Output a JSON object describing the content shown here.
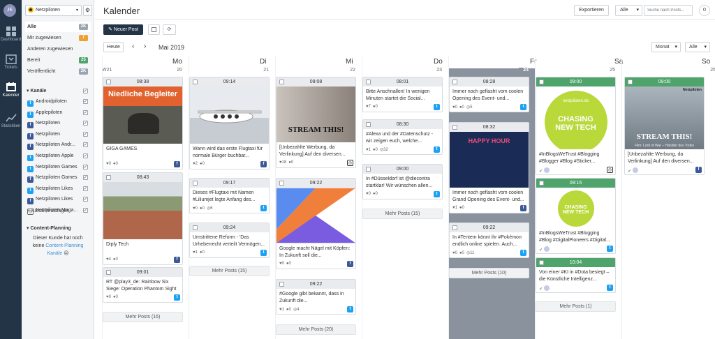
{
  "user": {
    "initials": "JE"
  },
  "rail": [
    {
      "label": "Dashboard",
      "icon": "dashboard-icon"
    },
    {
      "label": "Tickets",
      "icon": "tickets-icon"
    },
    {
      "label": "Kalender",
      "icon": "calendar-icon"
    },
    {
      "label": "Statistiken",
      "icon": "statistics-icon"
    }
  ],
  "sidebar": {
    "workspace": "Netzpiloten",
    "filters": [
      {
        "label": "Alle",
        "badge": "2K",
        "color": "#9aa5b1"
      },
      {
        "label": "Mir zugewiesen",
        "badge": "7",
        "color": "#f0a030"
      },
      {
        "label": "Anderen zugewiesen",
        "badge": "",
        "color": ""
      },
      {
        "label": "Bereit",
        "badge": "25",
        "color": "#4ea46a"
      },
      {
        "label": "Veröffentlicht",
        "badge": "2K",
        "color": "#9aa5b1"
      }
    ],
    "channels_title": "Kanäle",
    "channels": [
      {
        "label": "Androidpiloten",
        "net": "t"
      },
      {
        "label": "Applepiloten",
        "net": "t"
      },
      {
        "label": "Netzpiloten",
        "net": "f"
      },
      {
        "label": "Netzpiloten",
        "net": "f"
      },
      {
        "label": "Netzpiloten Andr...",
        "net": "f"
      },
      {
        "label": "Netzpiloten Apple",
        "net": "t"
      },
      {
        "label": "Netzpiloten Games",
        "net": "t"
      },
      {
        "label": "Netzpiloten Games",
        "net": "f"
      },
      {
        "label": "Netzpiloten Likes",
        "net": "t"
      },
      {
        "label": "Netzpiloten Likes",
        "net": "f"
      },
      {
        "label": "Netzpiloten Maga...",
        "net": "i"
      }
    ],
    "add_channel": "+ Kanal hinzufügen",
    "cp_title": "Content-Planning",
    "cp_line1": "Dieser Kunde hat noch",
    "cp_line2a": "keine",
    "cp_line2b": "Content-Planning",
    "cp_line3": "Kanäle"
  },
  "header": {
    "title": "Kalender",
    "export": "Exportieren",
    "filter_all": "Alle",
    "search_placeholder": "Suche nach Posts...",
    "count": "0"
  },
  "toolbar": {
    "new_post": "Neuer Post",
    "today": "Heute",
    "period": "Mai 2019",
    "view": "Monat",
    "filter": "Alle"
  },
  "week": "W21",
  "days": [
    {
      "name": "Mo",
      "num": "20",
      "more": "Mehr Posts (16)",
      "posts": [
        {
          "time": "08:38",
          "img": "niedlich",
          "text": "GIGA GAMES",
          "likes": "0",
          "comments": "0",
          "shares": "",
          "net": "f"
        },
        {
          "time": "08:43",
          "img": "construction",
          "text": "Diply Tech",
          "likes": "4",
          "comments": "0",
          "shares": "",
          "net": "f"
        },
        {
          "time": "09:01",
          "img": "",
          "text": "RT @play3_de: Rainbow Six Siege: Operation Phantom Sight –...",
          "likes": "0",
          "comments": "0",
          "shares": "",
          "net": "t"
        }
      ]
    },
    {
      "name": "Di",
      "num": "21",
      "more": "Mehr Posts (15)",
      "posts": [
        {
          "time": "09:14",
          "img": "plane",
          "text": "Wann wird das erste Flugtaxi für normale Bürger buchbar...",
          "likes": "2",
          "comments": "0",
          "shares": "",
          "net": "f"
        },
        {
          "time": "09:17",
          "img": "",
          "text": "Dieses #Flugtaxi mit Namen #Liliumjet legte Anfang des...",
          "likes": "0",
          "comments": "0",
          "shares": "6",
          "net": "t"
        },
        {
          "time": "09:24",
          "img": "",
          "text": "Umstrittene Reform - 'Das Urheberrecht verteilt Vermögen...",
          "likes": "1",
          "comments": "0",
          "shares": "",
          "net": "t"
        }
      ]
    },
    {
      "name": "Mi",
      "num": "22",
      "more": "Mehr Posts (20)",
      "posts": [
        {
          "time": "09:08",
          "img": "stream",
          "img_text": "STREAM THIS!",
          "text": "[Unbezahlte Werbung, da Verlinkung] Auf den diversen...",
          "likes": "18",
          "comments": "0",
          "shares": "",
          "net": "i"
        },
        {
          "time": "09:22",
          "img": "kotlin",
          "text": "Google macht Nägel mit Köpfen: In Zukunft soll die...",
          "likes": "0",
          "comments": "0",
          "shares": "",
          "net": "f"
        },
        {
          "time": "09:22",
          "img": "",
          "text": "#Google gibt bekannt, dass in Zukunft die...",
          "likes": "1",
          "comments": "0",
          "shares": "4",
          "net": "t"
        }
      ]
    },
    {
      "name": "Do",
      "num": "23",
      "more": "Mehr Posts (15)",
      "posts": [
        {
          "time": "08:01",
          "img": "",
          "text": "Bitte Anschnallen! In wenigen Minuten startet die Social...",
          "likes": "7",
          "comments": "0",
          "shares": "",
          "net": "t"
        },
        {
          "time": "08:30",
          "img": "",
          "text": "#Alexa und der #Datenschutz - wir zeigen euch, welche...",
          "likes": "1",
          "comments": "0",
          "shares": "32",
          "net": "t"
        },
        {
          "time": "09:00",
          "img": "",
          "text": "In #Düsseldorf ist @diecontra startklar! Wir wünschen allen...",
          "likes": "0",
          "comments": "0",
          "shares": "",
          "net": "t"
        }
      ]
    },
    {
      "name": "Fr",
      "num": "24",
      "more": "Mehr Posts (10)",
      "posts": [
        {
          "time": "08:28",
          "img": "",
          "text": "Immer noch geflasht vom coolen Opening des Event- und...",
          "likes": "0",
          "comments": "0",
          "shares": "5",
          "net": "t"
        },
        {
          "time": "08:32",
          "img": "happy",
          "img_text": "HAPPY HOUR",
          "text": "Immer noch geflasht vom coolen Grand Opening des Event- und...",
          "likes": "1",
          "comments": "0",
          "shares": "",
          "net": "f"
        },
        {
          "time": "09:22",
          "img": "",
          "text": "In #Tentem könnt ihr #Pokémon endlich online spielen. Auch...",
          "likes": "0",
          "comments": "0",
          "shares": "11",
          "net": "t"
        }
      ]
    },
    {
      "name": "Sa",
      "num": "25",
      "more": "Mehr Posts (1)",
      "posts": [
        {
          "time": "09:00",
          "img": "chasing",
          "img_brand": "netzpiloten.de",
          "img_text": "CHASING NEW TECH",
          "text": "#InBlogsWeTrust #Blogging #Blogger #Blog #Sticker...",
          "net": "i"
        },
        {
          "time": "09:15",
          "img": "chasing2",
          "img_text": "CHASING NEW TECH",
          "text": "#InBlogsWeTrust #Blogging #Blog #DigitalPioneers #Digital...",
          "net": "t"
        },
        {
          "time": "10:04",
          "img": "",
          "text": "Von einer #KI in #Dota besiegt – die Künstliche Intelligenz...",
          "net": "t"
        }
      ]
    },
    {
      "name": "So",
      "num": "26",
      "more": "",
      "posts": [
        {
          "time": "09:00",
          "img": "stream2",
          "img_brand": "Netzpiloten",
          "img_text": "STREAM THIS!",
          "img_sub": "Film: Lord of War – Händler des Todes",
          "text": "[Unbezahlte Werbung, da Verlinkung] Auf den diversen...",
          "net": "f"
        }
      ]
    }
  ]
}
